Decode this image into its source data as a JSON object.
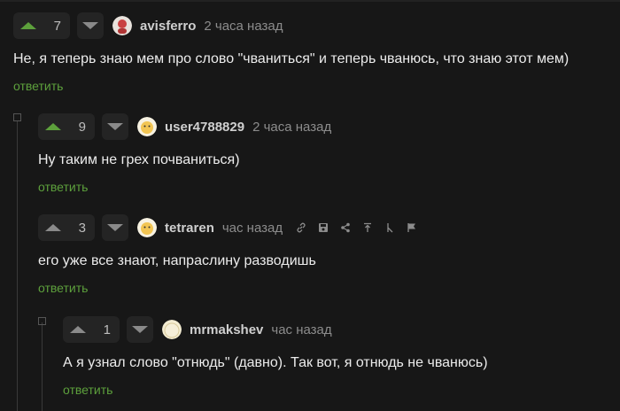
{
  "comments": [
    {
      "votes": "7",
      "username": "avisferro",
      "time": "2 часа назад",
      "text": "Не, я теперь знаю мем про слово \"чваниться\" и теперь чванюсь, что знаю этот мем)",
      "reply": "ответить"
    },
    {
      "votes": "9",
      "username": "user4788829",
      "time": "2 часа назад",
      "text": "Ну таким не грех почваниться)",
      "reply": "ответить"
    },
    {
      "votes": "3",
      "username": "tetraren",
      "time": "час назад",
      "text": "его уже все знают, напраслину разводишь",
      "reply": "ответить"
    },
    {
      "votes": "1",
      "username": "mrmakshev",
      "time": "час назад",
      "text": "А я узнал слово \"отнюдь\" (давно). Так вот, я отнюдь не чванюсь)",
      "reply": "ответить"
    }
  ],
  "colors": {
    "accent": "#5da03c",
    "background": "#171717",
    "text": "#ececec",
    "muted": "#8c8c8c"
  },
  "icons": [
    "link-icon",
    "save-icon",
    "share-icon",
    "pin-icon",
    "branch-icon",
    "flag-icon"
  ]
}
